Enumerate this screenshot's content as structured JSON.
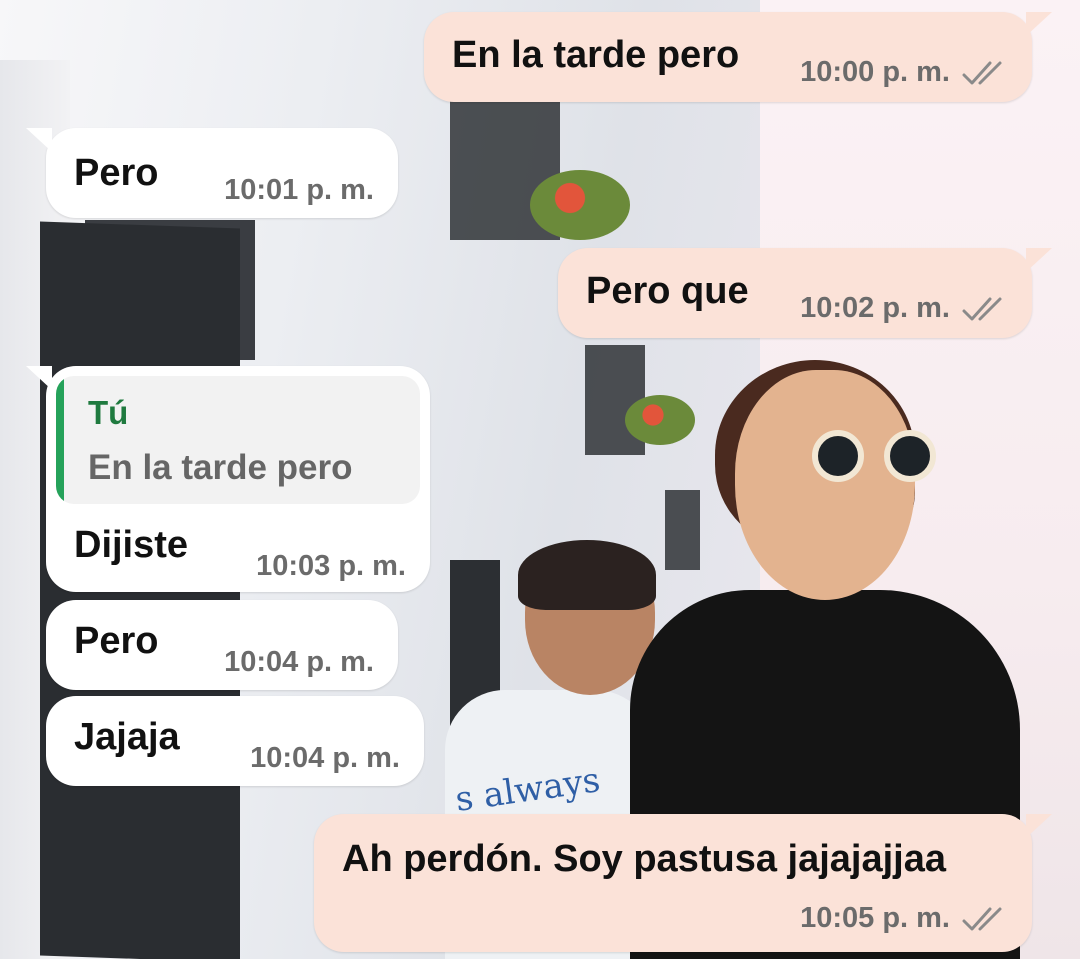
{
  "colors": {
    "incoming_bubble": "#ffffff",
    "outgoing_bubble": "#fbe2d8",
    "timestamp": "#6b6b6b",
    "quote_bar": "#25a25a",
    "quote_author": "#1f7a3f"
  },
  "wallpaper": {
    "description_icon": "photo-wallpaper",
    "shirt_text": "s always"
  },
  "messages": [
    {
      "direction": "outgoing",
      "text": "En la tarde pero",
      "time": "10:00 p. m.",
      "status_icon": "double-check-icon"
    },
    {
      "direction": "incoming",
      "text": "Pero",
      "time": "10:01 p. m."
    },
    {
      "direction": "outgoing",
      "text": "Pero que",
      "time": "10:02 p. m.",
      "status_icon": "double-check-icon"
    },
    {
      "direction": "incoming",
      "text": "Dijiste",
      "time": "10:03 p. m.",
      "reply_to": {
        "author": "Tú",
        "text": "En la tarde pero"
      }
    },
    {
      "direction": "incoming",
      "text": "Pero",
      "time": "10:04 p. m."
    },
    {
      "direction": "incoming",
      "text": "Jajaja",
      "time": "10:04 p. m."
    },
    {
      "direction": "outgoing",
      "text": "Ah perdón. Soy pastusa jajajajjaa",
      "time": "10:05 p. m.",
      "status_icon": "double-check-icon"
    }
  ]
}
